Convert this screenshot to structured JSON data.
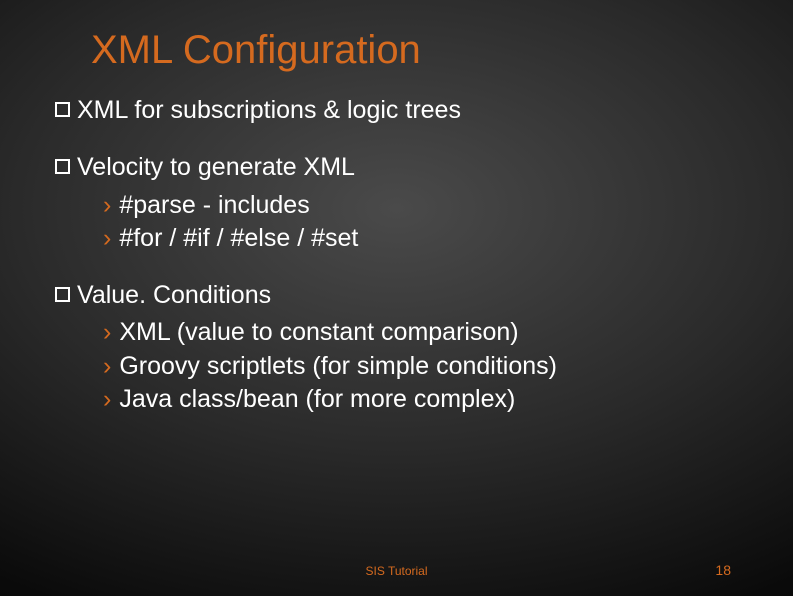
{
  "title": "XML Configuration",
  "bullets": [
    {
      "text": "XML for subscriptions & logic trees",
      "subs": []
    },
    {
      "text": "Velocity to generate XML",
      "subs": [
        "#parse - includes",
        "#for / #if / #else / #set"
      ]
    },
    {
      "text": "Value. Conditions",
      "subs": [
        "XML (value to constant comparison)",
        "Groovy scriptlets (for simple conditions)",
        "Java class/bean (for more complex)"
      ]
    }
  ],
  "footer": {
    "center": "SIS Tutorial",
    "page": "18"
  }
}
